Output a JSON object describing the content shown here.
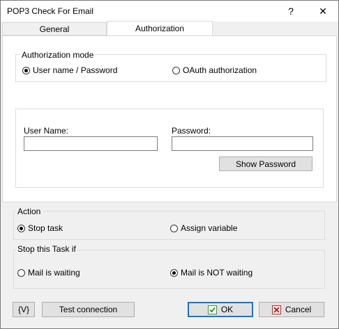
{
  "window": {
    "title": "POP3 Check For Email",
    "help_glyph": "?",
    "close_glyph": "✕"
  },
  "tabs": [
    {
      "label": "General"
    },
    {
      "label": "Authorization"
    }
  ],
  "authorization_mode": {
    "label": "Authorization mode",
    "options": [
      {
        "label": "User name / Password",
        "selected": true
      },
      {
        "label": "OAuth authorization",
        "selected": false
      }
    ]
  },
  "credentials": {
    "username_label": "User Name:",
    "username_value": "",
    "password_label": "Password:",
    "password_value": "",
    "show_password_label": "Show Password"
  },
  "action": {
    "label": "Action",
    "options": [
      {
        "label": "Stop task",
        "selected": true
      },
      {
        "label": "Assign variable",
        "selected": false
      }
    ]
  },
  "stop_if": {
    "label": "Stop this Task if",
    "options": [
      {
        "label": "Mail is waiting",
        "selected": false
      },
      {
        "label": "Mail is NOT waiting",
        "selected": true
      }
    ]
  },
  "footer": {
    "variables_label": "{V}",
    "test_label": "Test connection",
    "ok_label": "OK",
    "cancel_label": "Cancel"
  },
  "colors": {
    "ok_check": "#2e9b2e",
    "cancel_x": "#cc1a1a",
    "focus_border": "#0078d7"
  }
}
